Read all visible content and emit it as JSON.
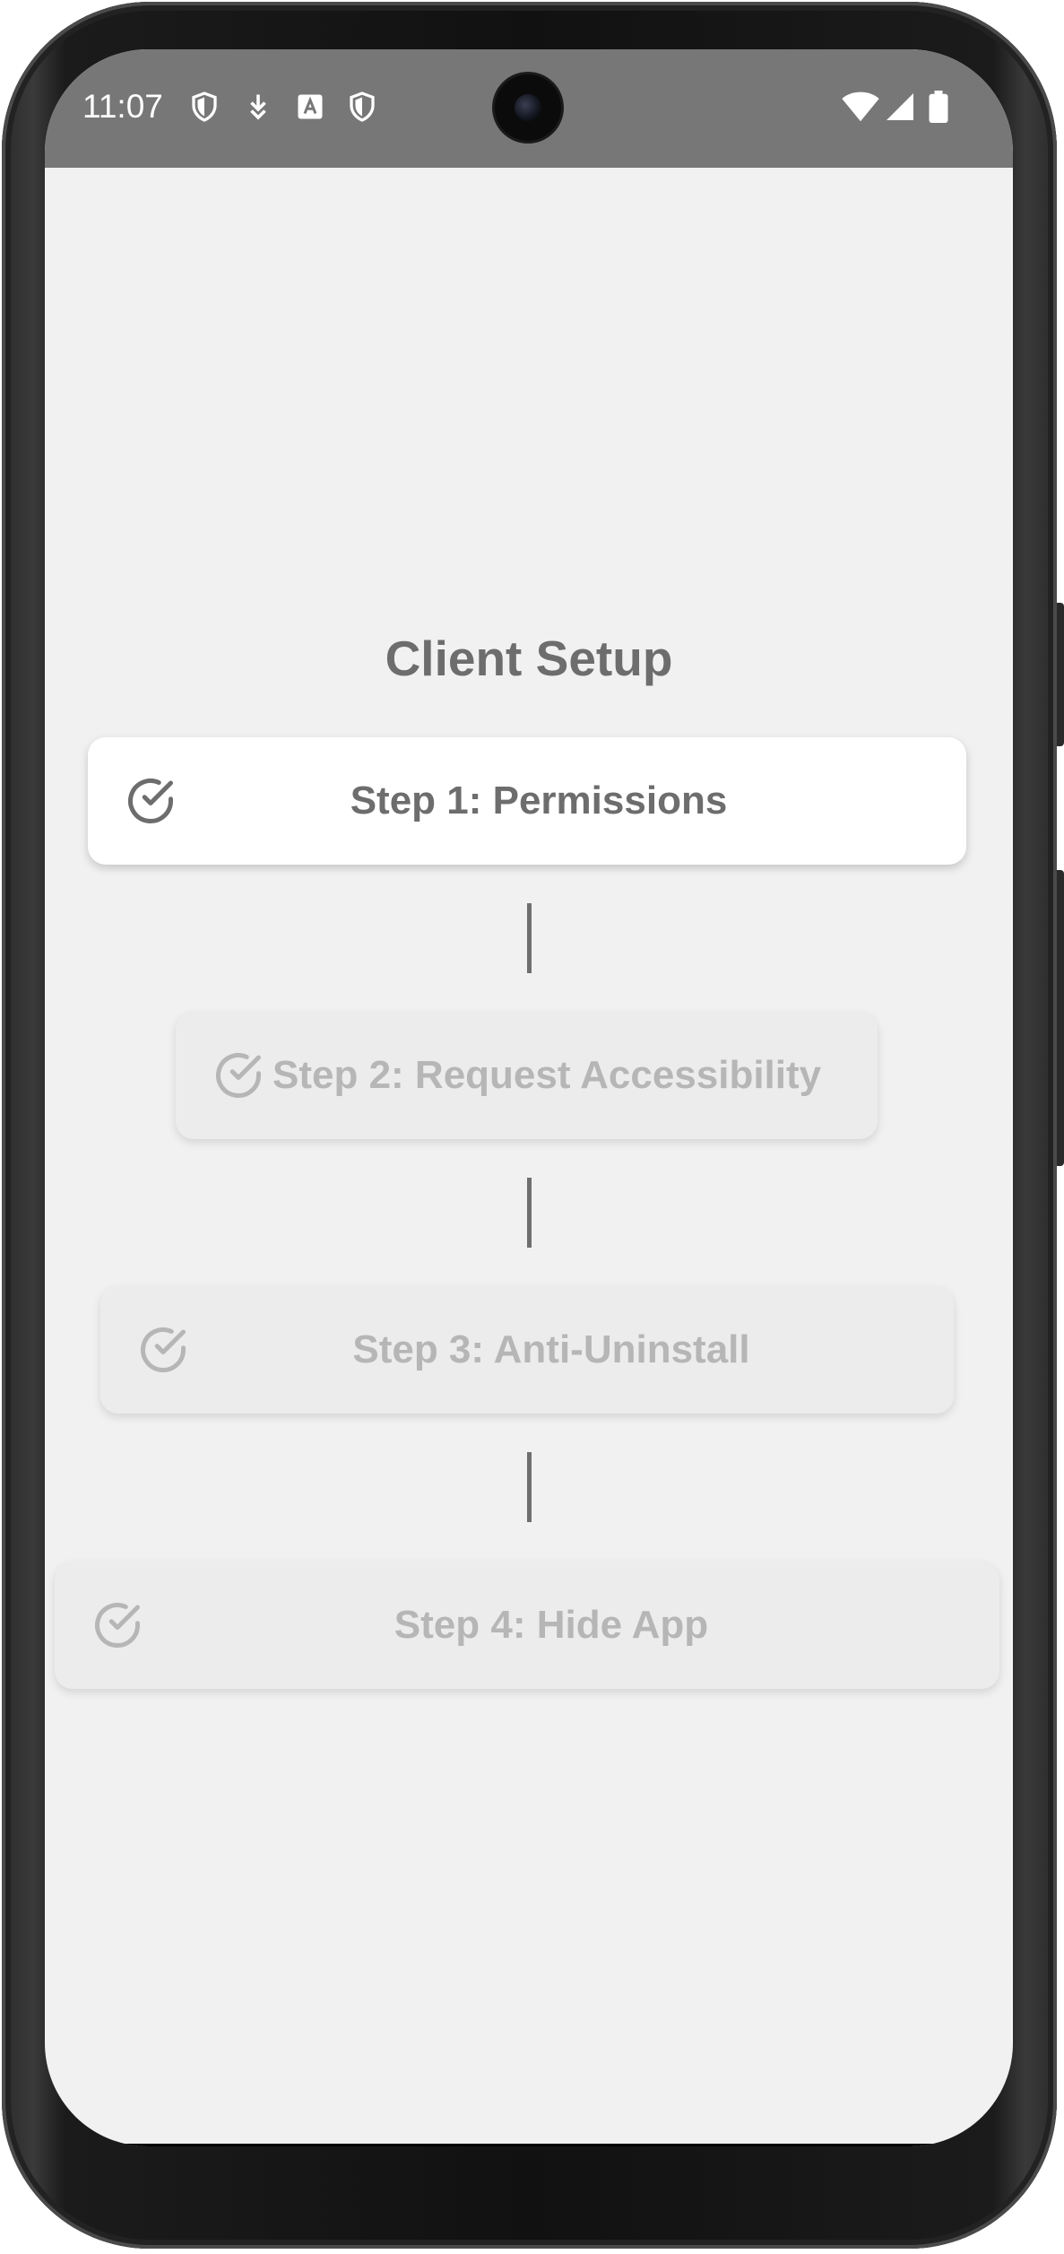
{
  "status_bar": {
    "time": "11:07",
    "left_icons": [
      "shield-icon",
      "download-icon",
      "font-icon",
      "shield-icon"
    ],
    "right_icons": [
      "wifi-icon",
      "signal-icon",
      "battery-icon"
    ]
  },
  "screen": {
    "title": "Client Setup",
    "steps": [
      {
        "label": "Step 1: Permissions",
        "icon": "check-circle-icon",
        "state": "active"
      },
      {
        "label": "Step 2: Request Accessibility",
        "icon": "check-circle-icon",
        "state": "inactive"
      },
      {
        "label": "Step 3: Anti-Uninstall",
        "icon": "check-circle-icon",
        "state": "inactive"
      },
      {
        "label": "Step 4: Hide App",
        "icon": "check-circle-icon",
        "state": "inactive"
      }
    ]
  },
  "colors": {
    "status_bar_bg": "#777777",
    "screen_bg": "#f1f1f1",
    "active_card_bg": "#ffffff",
    "inactive_card_bg": "#ececec",
    "active_text": "#6d6d6d",
    "inactive_text": "#b6b6b6",
    "connector": "#6f6f6f"
  }
}
